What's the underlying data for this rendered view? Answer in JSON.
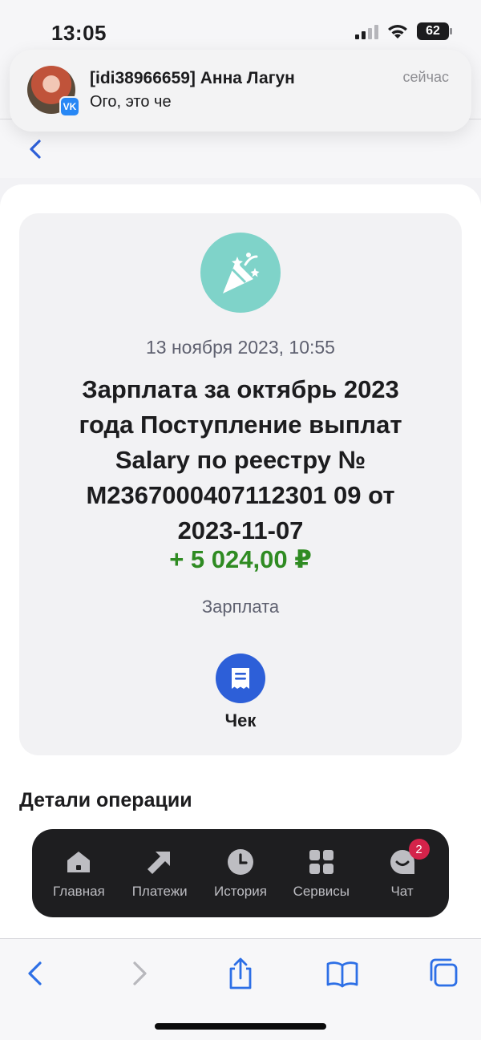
{
  "status_bar": {
    "time": "13:05",
    "battery": "62"
  },
  "notification": {
    "app": "VK",
    "title": "[idi38966659] Анна Лагун",
    "message": "Ого, это че",
    "time": "сейчас"
  },
  "operation": {
    "date": "13 ноября 2023, 10:55",
    "title": "Зарплата за октябрь 2023 года Поступление выплат Salary по реестру № М2367000407112301 09 от 2023-11-07",
    "amount": "+ 5 024,00 ₽",
    "category": "Зарплата",
    "check_label": "Чек",
    "icon": "party-popper-icon"
  },
  "details": {
    "title": "Детали операции"
  },
  "tabbar": {
    "items": [
      {
        "label": "Главная",
        "icon": "home-icon"
      },
      {
        "label": "Платежи",
        "icon": "arrow-icon"
      },
      {
        "label": "История",
        "icon": "clock-icon"
      },
      {
        "label": "Сервисы",
        "icon": "grid-icon"
      },
      {
        "label": "Чат",
        "icon": "chat-icon",
        "badge": "2"
      }
    ]
  },
  "colors": {
    "accent": "#2d5fd8",
    "amount_positive": "#2f8b22",
    "icon_bg": "#7fd3c9",
    "tabbar_bg": "#1e1e20",
    "badge": "#d4234a"
  }
}
